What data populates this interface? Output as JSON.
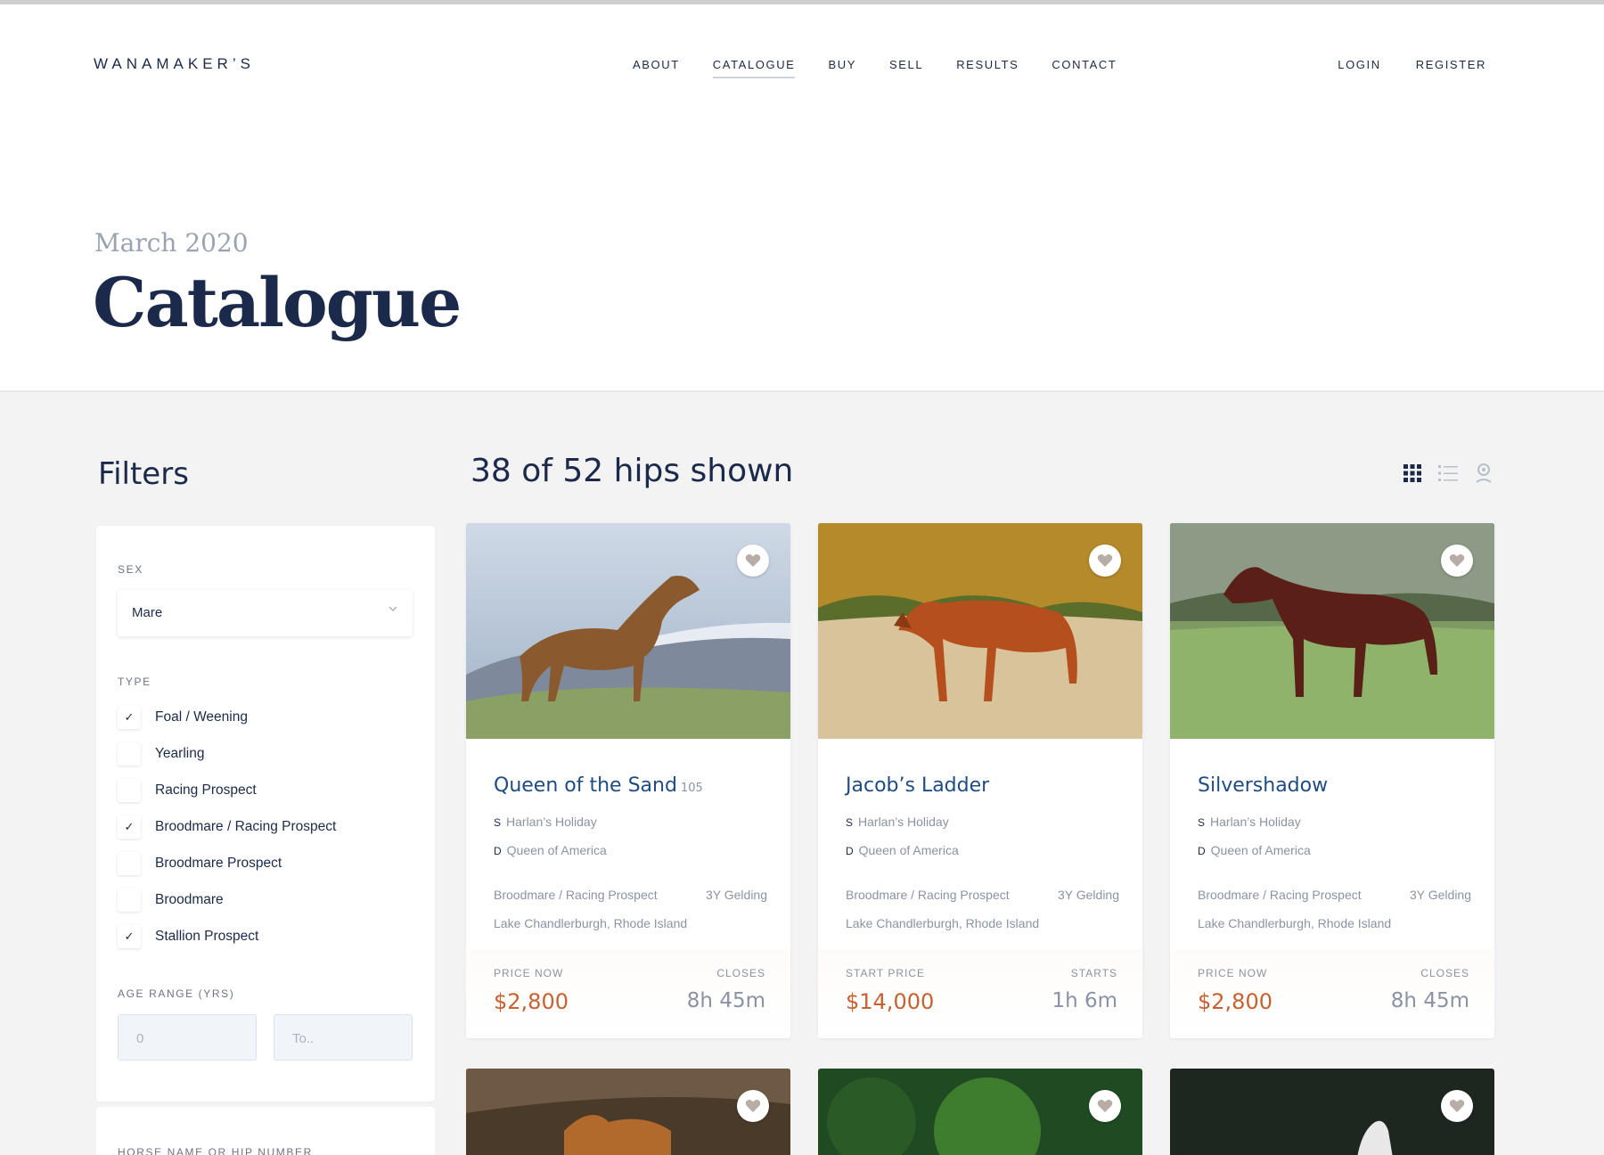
{
  "brand": "WANAMAKER’S",
  "nav": {
    "items": [
      "ABOUT",
      "CATALOGUE",
      "BUY",
      "SELL",
      "RESULTS",
      "CONTACT"
    ],
    "active": "CATALOGUE",
    "auth": [
      "LOGIN",
      "REGISTER"
    ]
  },
  "hero": {
    "subtitle": "March 2020",
    "title": "Catalogue"
  },
  "filters": {
    "heading": "Filters",
    "sex_label": "SEX",
    "sex_value": "Mare",
    "type_label": "TYPE",
    "types": [
      {
        "label": "Foal / Weening",
        "checked": true
      },
      {
        "label": "Yearling",
        "checked": false
      },
      {
        "label": "Racing Prospect",
        "checked": false
      },
      {
        "label": "Broodmare / Racing Prospect",
        "checked": true
      },
      {
        "label": "Broodmare Prospect",
        "checked": false
      },
      {
        "label": "Broodmare",
        "checked": false
      },
      {
        "label": "Stallion Prospect",
        "checked": true
      }
    ],
    "age_label": "AGE RANGE (YRS)",
    "age_from_placeholder": "0",
    "age_to_placeholder": "To..",
    "next_label": "HORSE NAME OR HIP NUMBER"
  },
  "results": {
    "count_text": "38 of 52 hips shown",
    "views": [
      "grid-view-icon",
      "list-view-icon",
      "map-pin-icon"
    ]
  },
  "cards": [
    {
      "name": "Queen of the Sand",
      "hip": "105",
      "sire_prefix": "S",
      "sire": "Harlan’s Holiday",
      "dam_prefix": "D",
      "dam": "Queen of America",
      "type": "Broodmare / Racing Prospect",
      "age_sex": "3Y Gelding",
      "location": "Lake Chandlerburgh, Rhode Island",
      "price_label": "PRICE NOW",
      "price": "$2,800",
      "time_label": "CLOSES",
      "time": "8h 45m"
    },
    {
      "name": "Jacob’s Ladder",
      "hip": "",
      "sire_prefix": "S",
      "sire": "Harlan’s Holiday",
      "dam_prefix": "D",
      "dam": "Queen of America",
      "type": "Broodmare / Racing Prospect",
      "age_sex": "3Y Gelding",
      "location": "Lake Chandlerburgh, Rhode Island",
      "price_label": "START PRICE",
      "price": "$14,000",
      "time_label": "STARTS",
      "time": "1h 6m"
    },
    {
      "name": "Silvershadow",
      "hip": "",
      "sire_prefix": "S",
      "sire": "Harlan’s Holiday",
      "dam_prefix": "D",
      "dam": "Queen of America",
      "type": "Broodmare / Racing Prospect",
      "age_sex": "3Y Gelding",
      "location": "Lake Chandlerburgh, Rhode Island",
      "price_label": "PRICE NOW",
      "price": "$2,800",
      "time_label": "CLOSES",
      "time": "8h 45m"
    }
  ],
  "colors": {
    "navy": "#1b2a4a",
    "link_blue": "#1f4b84",
    "price_orange": "#c8602f",
    "muted": "#8a93a3"
  }
}
